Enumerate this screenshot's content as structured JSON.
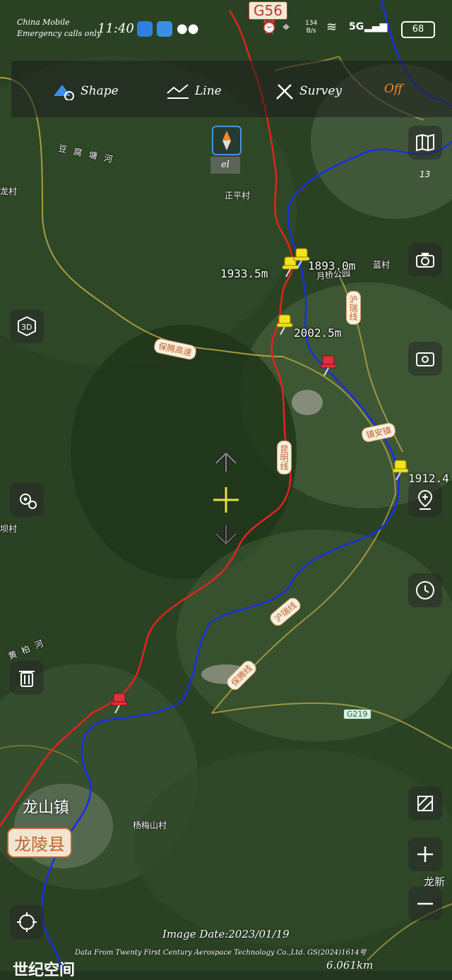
{
  "status_bar": {
    "carrier": "China Mobile",
    "emergency": "Emergency calls only",
    "time": "11:40",
    "net_speed_value": "134",
    "net_speed_unit": "B/s",
    "network": "5G",
    "battery": "68"
  },
  "toolbar": {
    "shape_label": "Shape",
    "line_label": "Line",
    "survey_label": "Survey",
    "toggle_label": "Off"
  },
  "compass": {
    "label": "el"
  },
  "side_scale_value": "13",
  "map_labels": {
    "river_north": "豆腐塘河",
    "village_zhengping": "正平村",
    "village_left_top": "龙村",
    "village_right_top": "蓝村",
    "village_yuefeng": "月桥公园",
    "village_left_mid": "坝村",
    "village_yangmei": "杨梅山村",
    "river_left": "黄柏河",
    "highway_baoteng": "保腾高速",
    "road_hurui": "沪瑞线",
    "town_zhenan": "镇安镇",
    "road_mid": "昆明线",
    "road_lower": "沪瑞线",
    "road_lower2": "保腾线",
    "shield_g219": "G219",
    "shield_g56": "G56",
    "town_longshan": "龙山镇",
    "county_longling": "龙陵县",
    "edge_right": "龙新"
  },
  "elevations": {
    "pin1": "1933.5m",
    "pin2": "1893.0m",
    "pin3": "2002.5m",
    "pin4": "1912.4"
  },
  "footer": {
    "image_date": "Image Date:2023/01/19",
    "credit": "Data From Twenty First Century Aerospace Technology Co.,Ltd. GS(2024)1614号",
    "scale": "6.061km",
    "logo_text": "世纪空间"
  },
  "colors": {
    "route_red": "#e3231d",
    "route_blue": "#1a2ee6",
    "road_yellow": "#c9b04a",
    "off_orange": "#f08a2a"
  }
}
